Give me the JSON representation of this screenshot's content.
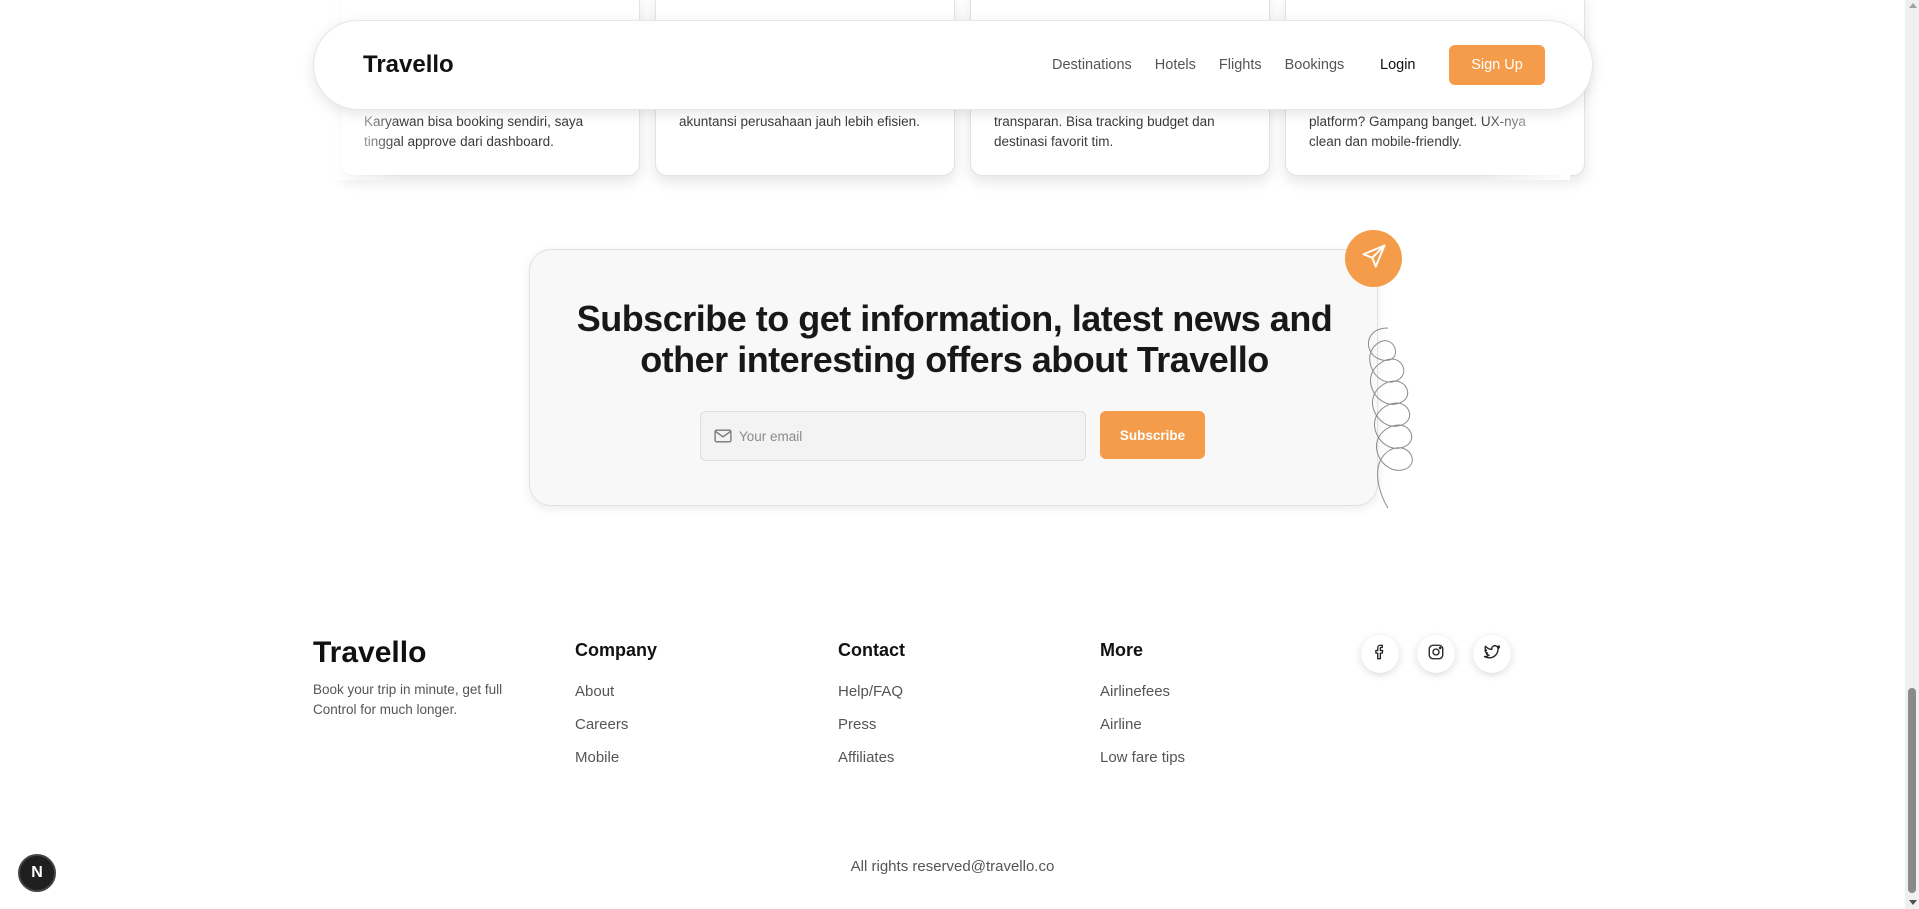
{
  "navbar": {
    "brand": "Travello",
    "links": [
      "Destinations",
      "Hotels",
      "Flights",
      "Bookings"
    ],
    "login": "Login",
    "signup": "Sign Up"
  },
  "testimonials": [
    {
      "text": "Karyawan bisa booking sendiri, saya tinggal approve dari dashboard."
    },
    {
      "text": "akuntansi perusahaan jauh lebih efisien."
    },
    {
      "text": "transparan. Bisa tracking budget dan destinasi favorit tim."
    },
    {
      "text": "platform? Gampang banget. UX-nya clean dan mobile-friendly."
    }
  ],
  "subscribe": {
    "title": "Subscribe to get information, latest news and other interesting offers about Travello",
    "email_placeholder": "Your email",
    "button": "Subscribe"
  },
  "footer": {
    "brand": "Travello",
    "tagline": "Book your trip in minute, get full Control for much longer.",
    "columns": [
      {
        "title": "Company",
        "links": [
          "About",
          "Careers",
          "Mobile"
        ]
      },
      {
        "title": "Contact",
        "links": [
          "Help/FAQ",
          "Press",
          "Affiliates"
        ]
      },
      {
        "title": "More",
        "links": [
          "Airlinefees",
          "Airline",
          "Low fare tips"
        ]
      }
    ],
    "socials": [
      "facebook-icon",
      "instagram-icon",
      "twitter-icon"
    ],
    "copyright": "All rights reserved@travello.co"
  },
  "dev_badge": "N",
  "colors": {
    "accent": "#f49c4a",
    "text": "#111111",
    "muted": "#555555"
  }
}
